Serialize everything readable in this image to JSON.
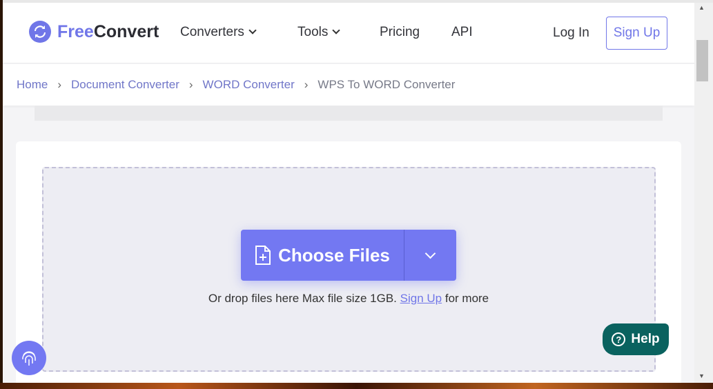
{
  "header": {
    "logo_free": "Free",
    "logo_convert": "Convert",
    "nav": [
      "Converters",
      "Tools",
      "Pricing",
      "API"
    ],
    "login": "Log In",
    "signup": "Sign Up"
  },
  "breadcrumb": [
    "Home",
    "Document Converter",
    "WORD Converter",
    "WPS To WORD Converter"
  ],
  "upload": {
    "choose_label": "Choose Files",
    "drop_text": "Or drop files here Max file size 1GB.",
    "signup_link": "Sign Up",
    "drop_suffix": "for more"
  },
  "help": {
    "label": "Help"
  },
  "colors": {
    "accent": "#7378f2",
    "help": "#0a625f"
  }
}
